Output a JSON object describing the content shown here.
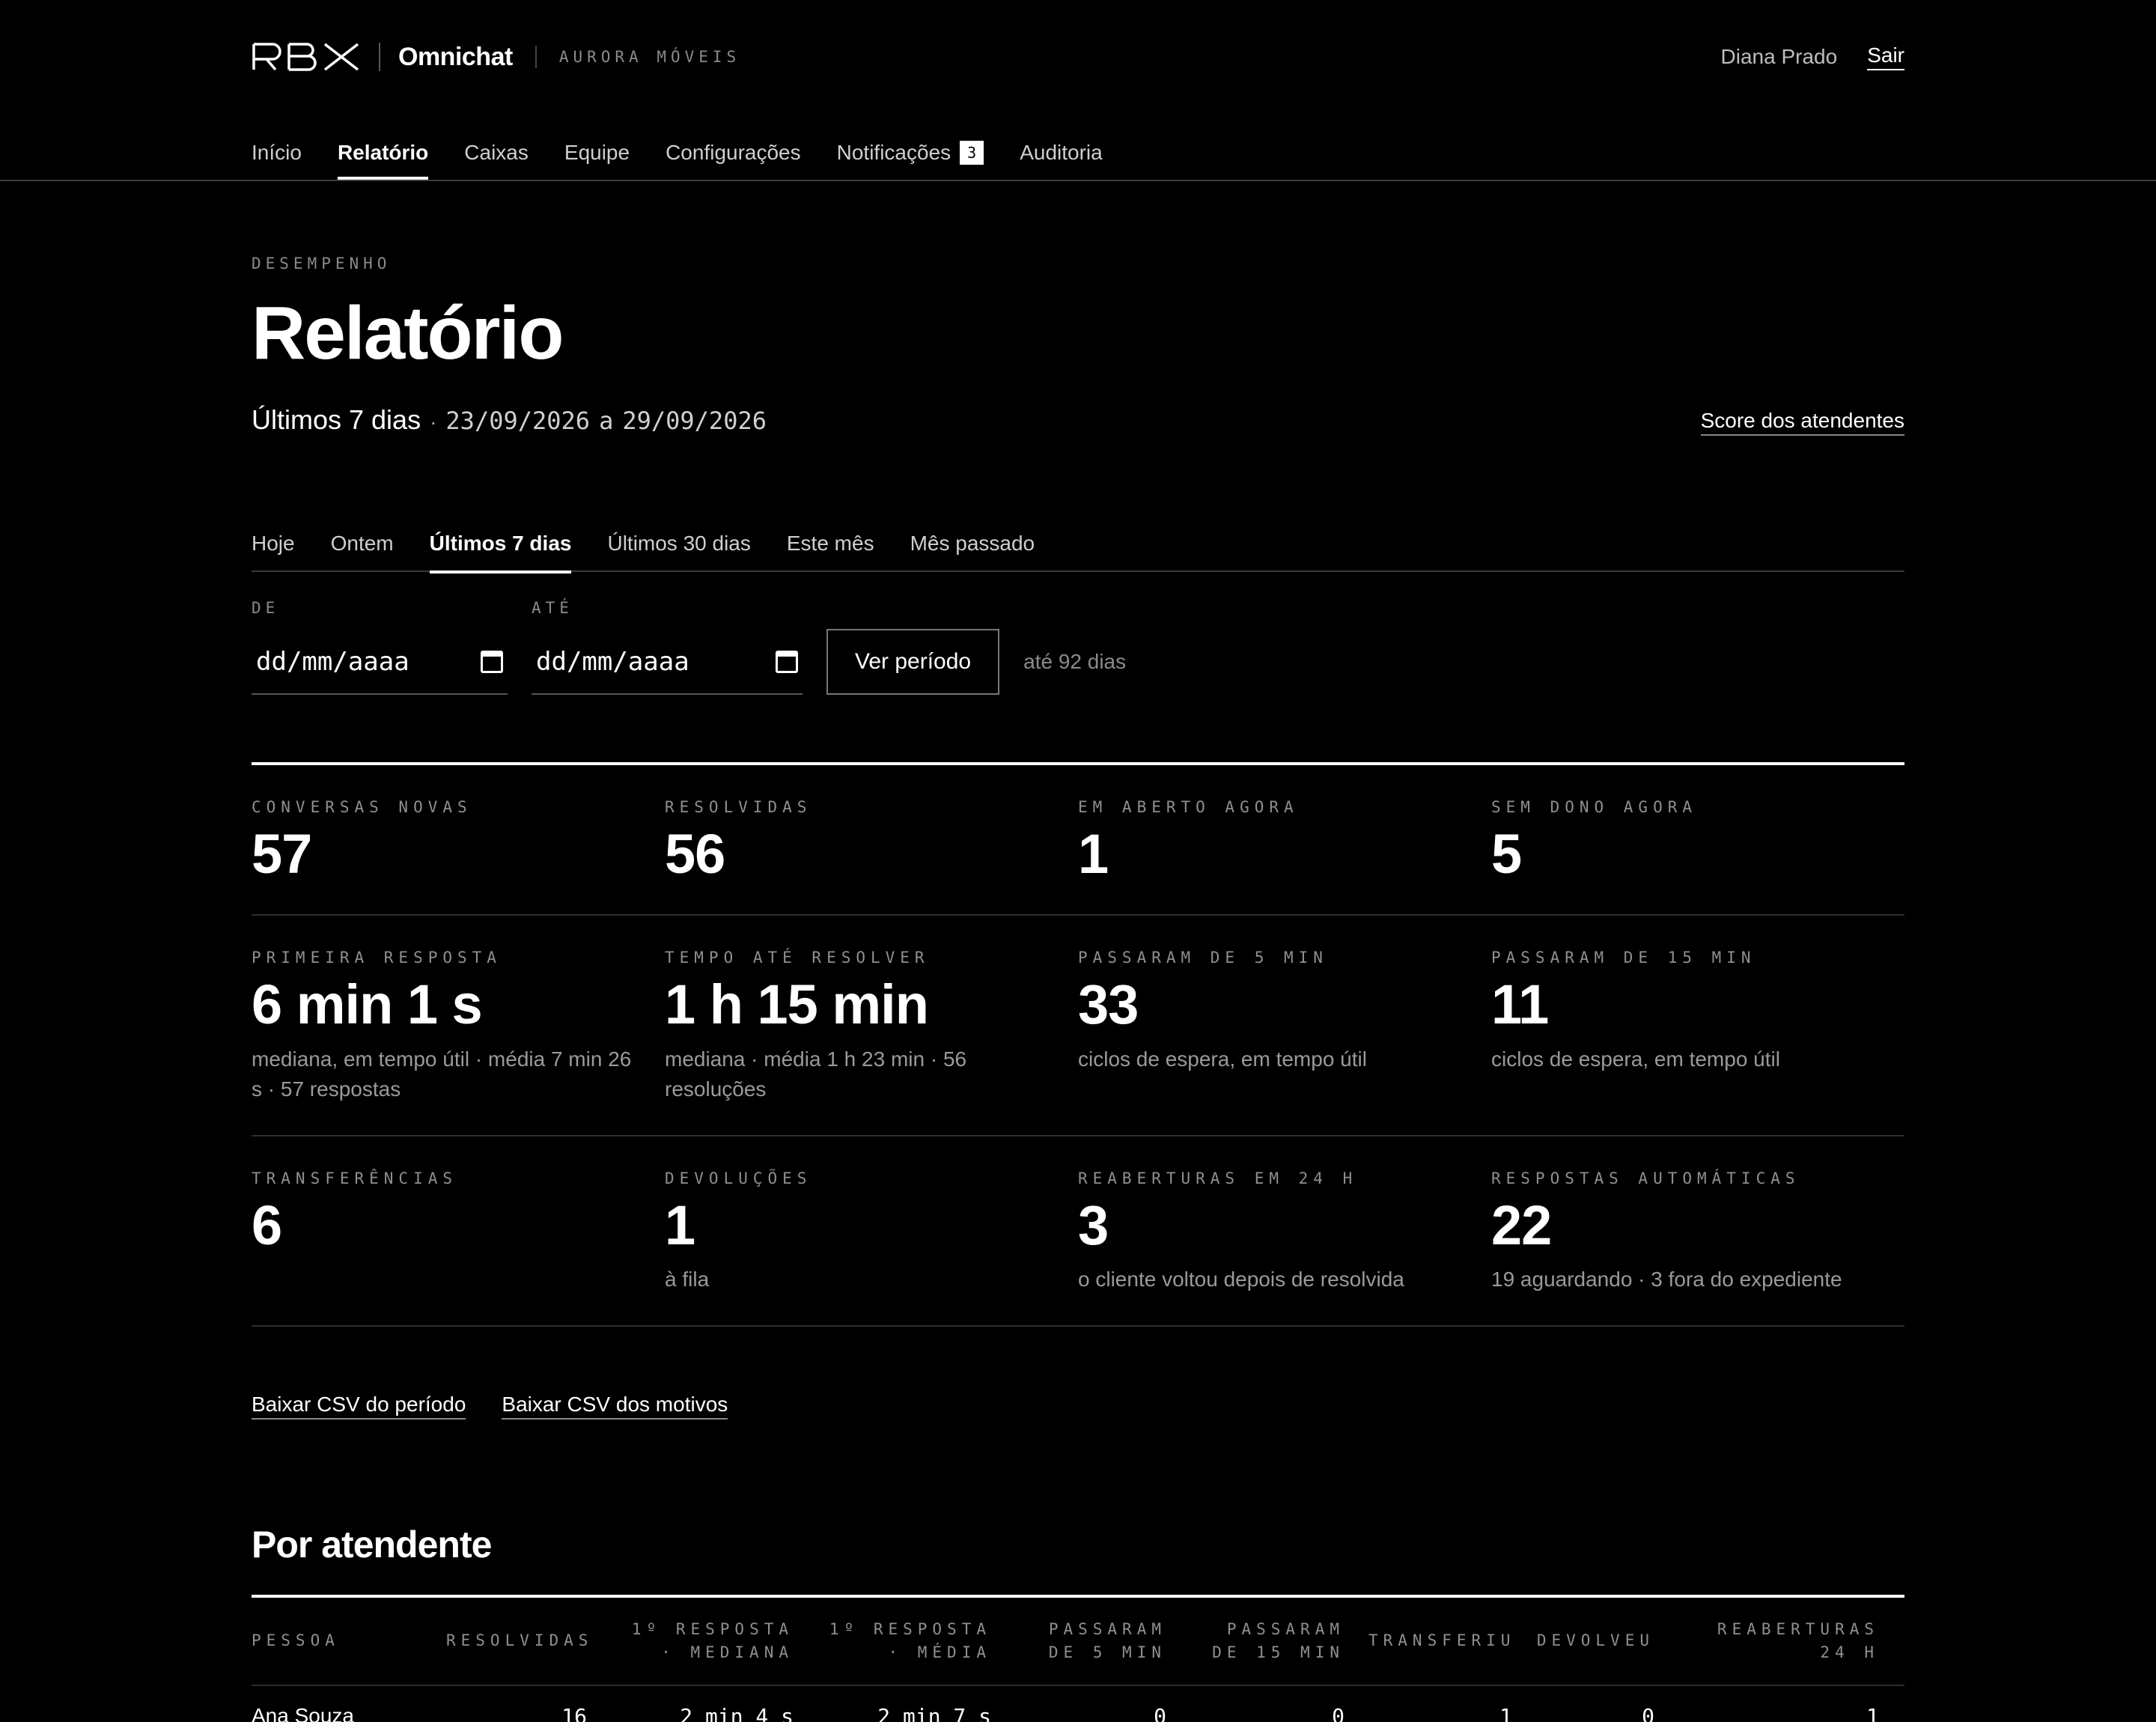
{
  "header": {
    "brand": "RBX",
    "product": "Omnichat",
    "tenant": "AURORA MÓVEIS",
    "user_name": "Diana Prado",
    "signout_label": "Sair"
  },
  "nav": {
    "items": [
      {
        "label": "Início"
      },
      {
        "label": "Relatório",
        "active": true
      },
      {
        "label": "Caixas"
      },
      {
        "label": "Equipe"
      },
      {
        "label": "Configurações"
      },
      {
        "label": "Notificações",
        "badge": "3"
      },
      {
        "label": "Auditoria"
      }
    ]
  },
  "page": {
    "eyebrow": "DESEMPENHO",
    "title": "Relatório",
    "period_label": "Últimos 7 dias",
    "separator": "·",
    "date_from": "23/09/2026",
    "date_conn": "a",
    "date_to": "29/09/2026",
    "score_link": "Score dos atendentes"
  },
  "period_tabs": [
    {
      "label": "Hoje"
    },
    {
      "label": "Ontem"
    },
    {
      "label": "Últimos 7 dias",
      "active": true
    },
    {
      "label": "Últimos 30 dias"
    },
    {
      "label": "Este mês"
    },
    {
      "label": "Mês passado"
    }
  ],
  "filters": {
    "from_label": "DE",
    "to_label": "ATÉ",
    "from_placeholder": "dd/mm/aaaa",
    "to_placeholder": "dd/mm/aaaa",
    "submit_label": "Ver período",
    "hint": "até 92 dias"
  },
  "kpis": [
    [
      {
        "label": "CONVERSAS NOVAS",
        "value": "57",
        "sub": ""
      },
      {
        "label": "RESOLVIDAS",
        "value": "56",
        "sub": ""
      },
      {
        "label": "EM ABERTO AGORA",
        "value": "1",
        "sub": ""
      },
      {
        "label": "SEM DONO AGORA",
        "value": "5",
        "sub": ""
      }
    ],
    [
      {
        "label": "PRIMEIRA RESPOSTA",
        "value": "6 min 1 s",
        "sub": "mediana, em tempo útil · média 7 min 26 s · 57 respostas"
      },
      {
        "label": "TEMPO ATÉ RESOLVER",
        "value": "1 h 15 min",
        "sub": "mediana · média 1 h 23 min · 56 resoluções"
      },
      {
        "label": "PASSARAM DE 5 MIN",
        "value": "33",
        "sub": "ciclos de espera, em tempo útil"
      },
      {
        "label": "PASSARAM DE 15 MIN",
        "value": "11",
        "sub": "ciclos de espera, em tempo útil"
      }
    ],
    [
      {
        "label": "TRANSFERÊNCIAS",
        "value": "6",
        "sub": ""
      },
      {
        "label": "DEVOLUÇÕES",
        "value": "1",
        "sub": "à fila"
      },
      {
        "label": "REABERTURAS EM 24 H",
        "value": "3",
        "sub": "o cliente voltou depois de resolvida"
      },
      {
        "label": "RESPOSTAS AUTOMÁTICAS",
        "value": "22",
        "sub": "19 aguardando · 3 fora do expediente"
      }
    ]
  ],
  "csv": {
    "period_label": "Baixar CSV do período",
    "reasons_label": "Baixar CSV dos motivos"
  },
  "agents": {
    "title": "Por atendente",
    "columns": [
      "PESSOA",
      "RESOLVIDAS",
      "1º RESPOSTA · MEDIANA",
      "1º RESPOSTA · MÉDIA",
      "PASSARAM DE 5 MIN",
      "PASSARAM DE 15 MIN",
      "TRANSFERIU",
      "DEVOLVEU",
      "REABERTURAS 24 H"
    ],
    "rows": [
      [
        "Ana Souza",
        "16",
        "2 min 4 s",
        "2 min 7 s",
        "0",
        "0",
        "1",
        "0",
        "1"
      ]
    ]
  }
}
